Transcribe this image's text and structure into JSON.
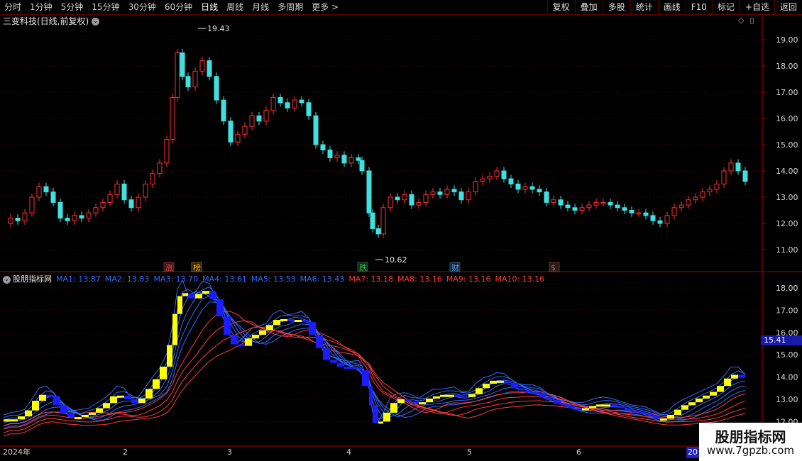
{
  "toolbar": {
    "periods": [
      "分时",
      "1分钟",
      "5分钟",
      "15分钟",
      "30分钟",
      "60分钟",
      "日线",
      "周线",
      "月线",
      "多周期",
      "更多 >"
    ],
    "active_period": "日线",
    "right_buttons": [
      "复权",
      "叠加",
      "多股",
      "统计",
      "画线",
      "F10",
      "标记",
      "+自选",
      "返回"
    ]
  },
  "chart": {
    "title": "三变科技(日线,前复权)",
    "high_label": "19.43",
    "low_label": "10.62",
    "price_axis": [
      "19.00",
      "18.00",
      "17.00",
      "16.00",
      "15.00",
      "14.00",
      "13.00",
      "12.00",
      "11.00"
    ],
    "event_tags": [
      {
        "text": "涨",
        "color": "#ff4040"
      },
      {
        "text": "榜",
        "color": "#ffb000"
      },
      {
        "text": "跌",
        "color": "#20c040"
      },
      {
        "text": "财",
        "color": "#40a0ff"
      },
      {
        "text": "$",
        "color": "#ff4040"
      }
    ]
  },
  "indicator": {
    "name": "股朋指标网",
    "ma_values": [
      {
        "label": "MA1: 13.87",
        "color": "blue"
      },
      {
        "label": "MA2: 13.83",
        "color": "blue"
      },
      {
        "label": "MA3: 13.70",
        "color": "blue"
      },
      {
        "label": "MA4: 13.61",
        "color": "blue"
      },
      {
        "label": "MA5: 13.53",
        "color": "blue"
      },
      {
        "label": "MA6: 13.43",
        "color": "blue"
      },
      {
        "label": "MA7: 13.18",
        "color": "red"
      },
      {
        "label": "MA8: 13.16",
        "color": "red"
      },
      {
        "label": "MA9: 13.16",
        "color": "red"
      },
      {
        "label": "MA10: 13.16",
        "color": "red"
      }
    ],
    "axis": [
      "18.00",
      "17.00",
      "16.00",
      "15.00",
      "14.00",
      "13.00",
      "12.00"
    ],
    "current_price": "15.41"
  },
  "dates": {
    "labels": [
      "2024年",
      "2",
      "3",
      "4",
      "5",
      "6"
    ],
    "current": "20"
  },
  "watermark": {
    "line1": "股朋指标网",
    "line2": "www.7gpzb.com"
  },
  "colors": {
    "up": "#ff3030",
    "down": "#40e0e0",
    "grid": "#5a0000",
    "ma_blue": "#2f6bff",
    "ma_red": "#ff3b3b"
  }
}
